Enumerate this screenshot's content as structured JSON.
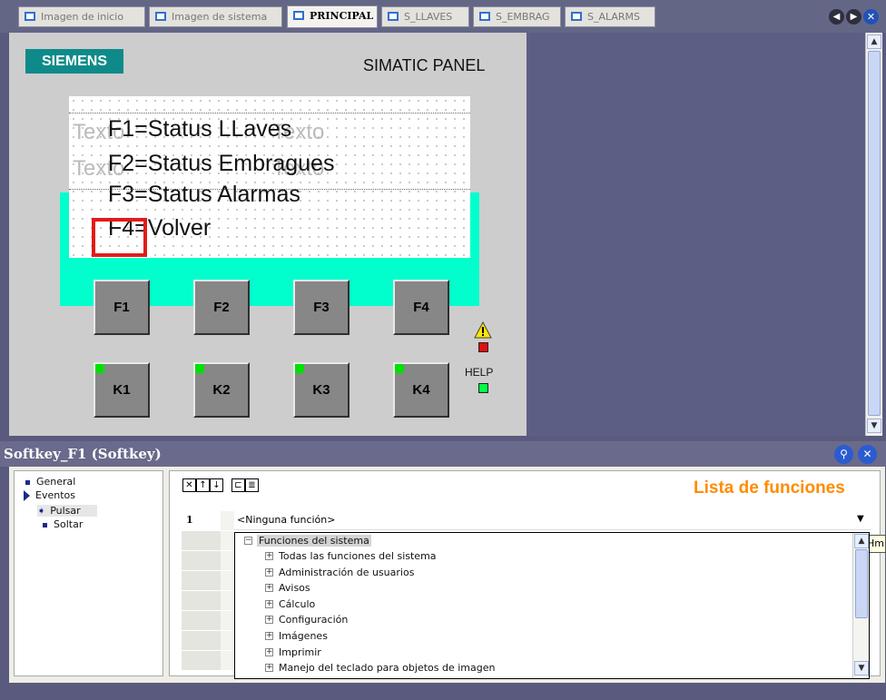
{
  "tabs": [
    {
      "label": "Imagen de inicio",
      "active": false
    },
    {
      "label": "Imagen de sistema",
      "active": false
    },
    {
      "label": "PRINCIPAL",
      "active": true
    },
    {
      "label": "S_LLAVES",
      "active": false
    },
    {
      "label": "S_EMBRAG",
      "active": false
    },
    {
      "label": "S_ALARMS",
      "active": false
    }
  ],
  "nav": {
    "prev_icon": "◀",
    "next_icon": "▶",
    "close_icon": "✕"
  },
  "panel": {
    "brand": "SIEMENS",
    "title": "SIMATIC PANEL",
    "ghost_text": "Texto",
    "lines": [
      "F1=Status LLaves",
      "F2=Status Embragues",
      "F3=Status Alarmas",
      "F4=Volver"
    ],
    "function_keys": [
      "F1",
      "F2",
      "F3",
      "F4"
    ],
    "k_keys": [
      "K1",
      "K2",
      "K3",
      "K4"
    ],
    "help_label": "HELP"
  },
  "properties": {
    "title": "Softkey_F1 (Softkey)",
    "tree": {
      "general": "General",
      "eventos": "Eventos",
      "pulsar": "Pulsar",
      "soltar": "Soltar"
    },
    "list_title": "Lista de funciones",
    "row_number": "1",
    "selected_function": "<Ninguna función>",
    "tooltip": "Hmi",
    "dropdown": {
      "root": "Funciones del sistema",
      "items": [
        "Todas las funciones del sistema",
        "Administración de usuarios",
        "Avisos",
        "Cálculo",
        "Configuración",
        "Imágenes",
        "Imprimir",
        "Manejo del teclado para objetos de imagen"
      ]
    }
  },
  "colors": {
    "siemens_teal": "#0f8a8a",
    "display_cyan": "#00ffcc",
    "selection_red": "#e21b1b",
    "list_title_orange": "#ff8c00"
  }
}
